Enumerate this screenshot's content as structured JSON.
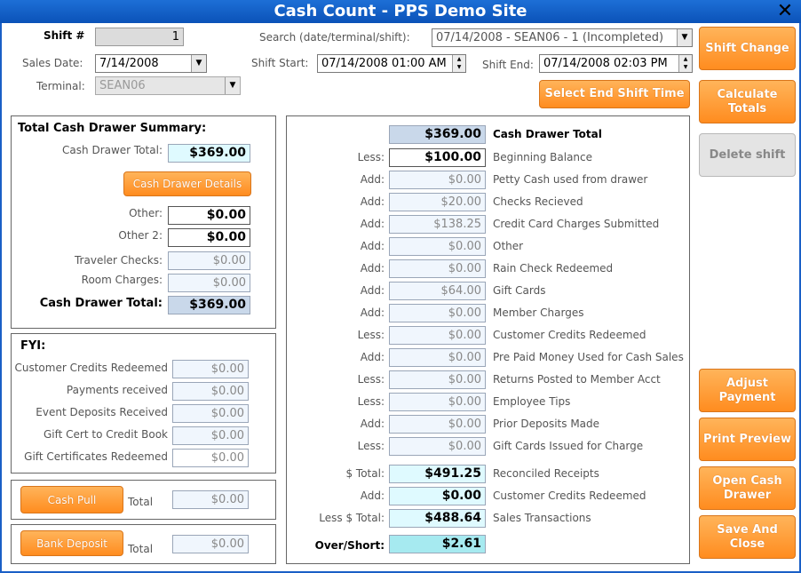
{
  "window": {
    "title": "Cash Count - PPS Demo Site"
  },
  "header": {
    "shift_label": "Shift #",
    "shift_value": "1",
    "sales_date_label": "Sales Date:",
    "sales_date_value": "7/14/2008",
    "terminal_label": "Terminal:",
    "terminal_value": "SEAN06",
    "search_label": "Search (date/terminal/shift):",
    "search_value": "07/14/2008 - SEAN06 - 1 (Incompleted)",
    "shift_start_label": "Shift Start:",
    "shift_start_value": "07/14/2008 01:00 AM",
    "shift_end_label": "Shift End:",
    "shift_end_value": "07/14/2008 02:03 PM",
    "select_end_shift_label": "Select End Shift Time"
  },
  "summary": {
    "title": "Total Cash Drawer Summary:",
    "cash_drawer_total_label": "Cash Drawer Total:",
    "cash_drawer_total_value": "$369.00",
    "details_button": "Cash Drawer Details",
    "other_label": "Other:",
    "other_value": "$0.00",
    "other2_label": "Other 2:",
    "other2_value": "$0.00",
    "traveler_label": "Traveler Checks:",
    "traveler_value": "$0.00",
    "room_label": "Room Charges:",
    "room_value": "$0.00",
    "total_label": "Cash Drawer Total:",
    "total_value": "$369.00"
  },
  "fyi": {
    "title": "FYI:",
    "rows": [
      {
        "label": "Customer Credits Redeemed",
        "value": "$0.00",
        "white": false
      },
      {
        "label": "Payments received",
        "value": "$0.00",
        "white": false
      },
      {
        "label": "Event Deposits Received",
        "value": "$0.00",
        "white": false
      },
      {
        "label": "Gift Cert to Credit Book",
        "value": "$0.00",
        "white": false
      },
      {
        "label": "Gift Certificates Redeemed",
        "value": "$0.00",
        "white": true
      }
    ]
  },
  "cash_pull": {
    "button": "Cash Pull",
    "total_label": "Total",
    "total_value": "$0.00"
  },
  "bank_deposit": {
    "button": "Bank Deposit",
    "total_label": "Total",
    "total_value": "$0.00"
  },
  "recon": {
    "top": {
      "value": "$369.00",
      "desc": "Cash Drawer Total"
    },
    "rows": [
      {
        "prefix": "Less:",
        "value": "$100.00",
        "desc": "Beginning Balance",
        "style": "white"
      },
      {
        "prefix": "Add:",
        "value": "$0.00",
        "desc": "Petty Cash used from drawer",
        "style": "plain"
      },
      {
        "prefix": "Add:",
        "value": "$20.00",
        "desc": "Checks Recieved",
        "style": "plain"
      },
      {
        "prefix": "Add:",
        "value": "$138.25",
        "desc": "Credit Card Charges Submitted",
        "style": "plain"
      },
      {
        "prefix": "Add:",
        "value": "$0.00",
        "desc": "Other",
        "style": "plain"
      },
      {
        "prefix": "Add:",
        "value": "$0.00",
        "desc": "Rain Check Redeemed",
        "style": "plain"
      },
      {
        "prefix": "Add:",
        "value": "$64.00",
        "desc": "Gift Cards",
        "style": "plain"
      },
      {
        "prefix": "Add:",
        "value": "$0.00",
        "desc": "Member Charges",
        "style": "plain"
      },
      {
        "prefix": "Less:",
        "value": "$0.00",
        "desc": "Customer Credits Redeemed",
        "style": "plain"
      },
      {
        "prefix": "Add:",
        "value": "$0.00",
        "desc": "Pre Paid Money Used for Cash Sales",
        "style": "plain"
      },
      {
        "prefix": "Less:",
        "value": "$0.00",
        "desc": "Returns Posted to Member Acct",
        "style": "plain"
      },
      {
        "prefix": "Less:",
        "value": "$0.00",
        "desc": "Employee Tips",
        "style": "plain"
      },
      {
        "prefix": "Add:",
        "value": "$0.00",
        "desc": "Prior Deposits Made",
        "style": "plain"
      },
      {
        "prefix": "Less:",
        "value": "$0.00",
        "desc": "Gift Cards Issued for Charge",
        "style": "plain"
      }
    ],
    "totals": [
      {
        "prefix": "$ Total:",
        "value": "$491.25",
        "desc": "Reconciled Receipts"
      },
      {
        "prefix": "Add:",
        "value": "$0.00",
        "desc": "Customer Credits Redeemed"
      },
      {
        "prefix": "Less $ Total:",
        "value": "$488.64",
        "desc": "Sales Transactions"
      }
    ],
    "over_short_label": "Over/Short:",
    "over_short_value": "$2.61"
  },
  "actions": {
    "shift_change": "Shift Change",
    "calculate_totals": "Calculate Totals",
    "delete_shift": "Delete shift",
    "adjust_payment": "Adjust Payment",
    "print_preview": "Print Preview",
    "open_cash_drawer": "Open Cash Drawer",
    "save_and_close": "Save And Close"
  }
}
